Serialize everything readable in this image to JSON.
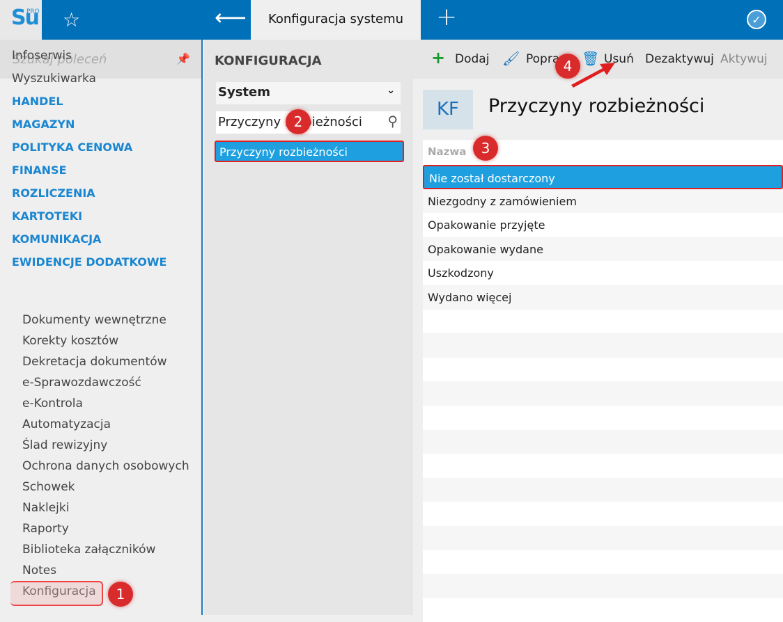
{
  "app": {
    "logo_text": "Su",
    "logo_sup": "PRO",
    "tab_title": "Konfiguracja systemu",
    "icons": [
      "star-icon",
      "back-arrow-icon",
      "plus-icon",
      "check-circle-icon"
    ]
  },
  "sidebar": {
    "search_placeholder": "Szukaj poleceń",
    "items": [
      {
        "label": "Infoserwis",
        "type": "link"
      },
      {
        "label": "Wyszukiwarka",
        "type": "link"
      },
      {
        "label": "HANDEL",
        "type": "cat"
      },
      {
        "label": "MAGAZYN",
        "type": "cat"
      },
      {
        "label": "POLITYKA CENOWA",
        "type": "cat"
      },
      {
        "label": "FINANSE",
        "type": "cat"
      },
      {
        "label": "ROZLICZENIA",
        "type": "cat"
      },
      {
        "label": "KARTOTEKI",
        "type": "cat"
      },
      {
        "label": "KOMUNIKACJA",
        "type": "cat"
      },
      {
        "label": "EWIDENCJE DODATKOWE",
        "type": "cat"
      }
    ],
    "subitems": [
      "Dokumenty wewnętrzne",
      "Korekty kosztów",
      "Dekretacja dokumentów",
      "e-Sprawozdawczość",
      "e-Kontrola",
      "Automatyzacja",
      "Ślad rewizyjny",
      "Ochrona danych osobowych",
      "Schowek",
      "Naklejki",
      "Raporty",
      "Biblioteka załączników",
      "Notes",
      "Konfiguracja"
    ]
  },
  "middle": {
    "heading": "KONFIGURACJA",
    "select_value": "System",
    "filter_value": "Przyczyny rozbieżności",
    "selected_item": "Przyczyny rozbieżności"
  },
  "toolbar": {
    "add": "Dodaj",
    "edit": "Popraw",
    "delete": "Usuń",
    "deactivate": "Dezaktywuj",
    "activate": "Aktywuj"
  },
  "main": {
    "avatar": "KF",
    "title": "Przyczyny rozbieżności",
    "column": "Nazwa",
    "rows": [
      "Nie został dostarczony",
      "Niezgodny z zamówieniem",
      "Opakowanie przyjęte",
      "Opakowanie wydane",
      "Uszkodzony",
      "Wydano więcej"
    ]
  },
  "badges": [
    "1",
    "2",
    "3",
    "4"
  ],
  "colors": {
    "accent": "#0070b8",
    "selection": "#1ea0e0",
    "category": "#1a86d0",
    "annotation": "#d92b2b"
  }
}
